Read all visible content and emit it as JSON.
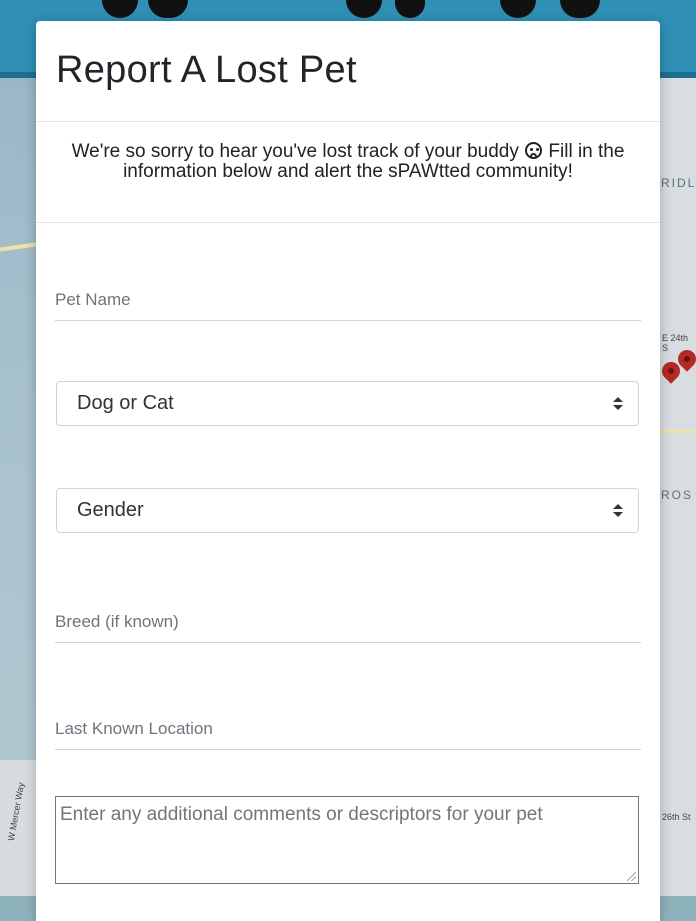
{
  "modal": {
    "title": "Report A Lost Pet",
    "intro_before_icon": "We're so sorry to hear you've lost track of your buddy",
    "intro_icon": "sad-face-icon",
    "intro_after_icon": "Fill in the information below and alert the sPAWtted community!"
  },
  "form": {
    "pet_name_placeholder": "Pet Name",
    "type_select_value": "Dog or Cat",
    "gender_select_value": "Gender",
    "breed_placeholder": "Breed (if known)",
    "location_placeholder": "Last Known Location",
    "comments_placeholder": "Enter any additional comments or descriptors for your pet"
  },
  "background_map": {
    "labels": [
      "RIDL",
      "E 24th S",
      "ROS",
      "W Mercer Way",
      "26th St"
    ]
  },
  "colors": {
    "header_blue": "#2f8fb4",
    "map_pin": "#b52a22"
  }
}
